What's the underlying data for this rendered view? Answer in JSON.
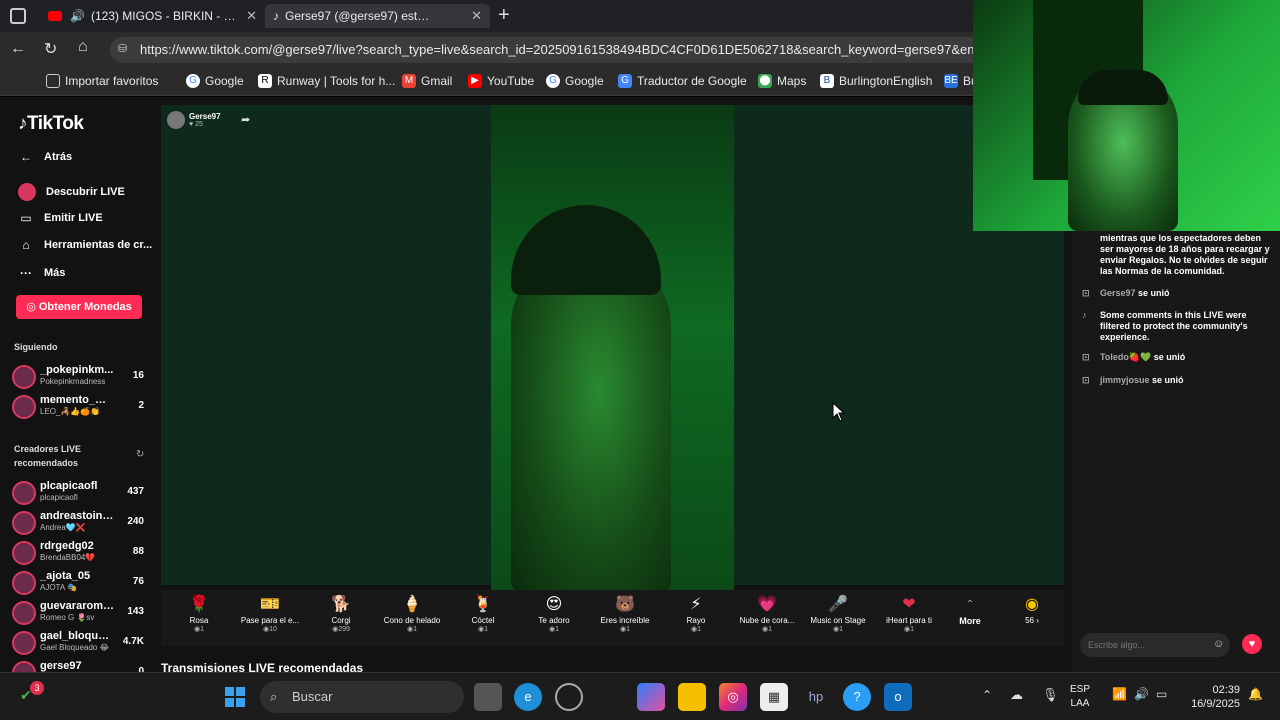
{
  "browser": {
    "tabs": [
      {
        "title": "(123) MIGOS - BIRKIN - 60 M",
        "icon": "youtube-icon"
      },
      {
        "title": "Gerse97 (@gerse97) está LIVE: Ti",
        "icon": "tiktok-icon"
      }
    ],
    "url": "https://www.tiktok.com/@gerse97/live?search_type=live&search_id=20250916153849​4BDC4CF0D61DE5062718&search_keyword=gerse97&ent",
    "bookmarks": [
      "Importar favoritos",
      "Google",
      "Runway | Tools for h...",
      "Gmail",
      "YouTube",
      "Google",
      "Traductor de Google",
      "Maps",
      "BurlingtonEnglish",
      "Bu"
    ]
  },
  "sidebar": {
    "logo": "TikTok",
    "back": "Atrás",
    "nav": [
      "Descubrir LIVE",
      "Emitir LIVE",
      "Herramientas de cr...",
      "Más"
    ],
    "coins_button": "Obtener Monedas",
    "following_label": "Siguiendo",
    "following": [
      {
        "name": "_pokepinkm...",
        "sub": "Pokepinkmadness",
        "count": "16"
      },
      {
        "name": "memento_mo...",
        "sub": "LEO_🦂👍🍊👏",
        "count": "2"
      }
    ],
    "recommended_label": "Creadores LIVE recomendados",
    "recommended": [
      {
        "name": "plcapicaofl",
        "sub": "plcapicaofl",
        "count": "437"
      },
      {
        "name": "andreastoinf...",
        "sub": "Andrea🩵❌",
        "count": "240"
      },
      {
        "name": "rdrgedg02",
        "sub": "BrendaBB04💔",
        "count": "88"
      },
      {
        "name": "_ajota_05",
        "sub": "AJOTA 🎭",
        "count": "76"
      },
      {
        "name": "guevararomeo",
        "sub": "Romeo G 🌷sv",
        "count": "143"
      },
      {
        "name": "gael_bloquea...",
        "sub": "Gael Bloqueado 😂",
        "count": "4.7K"
      },
      {
        "name": "gerse97",
        "sub": "",
        "count": "0"
      }
    ]
  },
  "stream": {
    "host": "Gerse97",
    "viewers": "25",
    "recommended_heading": "Transmisiones LIVE recomendadas"
  },
  "gifts": [
    {
      "name": "Rosa",
      "price": "1",
      "icon": "🌹"
    },
    {
      "name": "Pase para el e...",
      "price": "10",
      "icon": "🎫"
    },
    {
      "name": "Corgi",
      "price": "299",
      "icon": "🐕"
    },
    {
      "name": "Cono de helado",
      "price": "1",
      "icon": "🍦"
    },
    {
      "name": "Cóctel",
      "price": "1",
      "icon": "🍹"
    },
    {
      "name": "Te adoro",
      "price": "1",
      "icon": "😍"
    },
    {
      "name": "Eres increíble",
      "price": "1",
      "icon": "🐻"
    },
    {
      "name": "Rayo",
      "price": "1",
      "icon": "⚡"
    },
    {
      "name": "Nube de cora...",
      "price": "1",
      "icon": "💗"
    },
    {
      "name": "Music on Stage",
      "price": "1",
      "icon": "🎤"
    },
    {
      "name": "iHeart para ti",
      "price": "1",
      "icon": "❤"
    }
  ],
  "gift_more": "More",
  "coin_balance": "56",
  "chat": {
    "messages": [
      {
        "user": "",
        "text": "mientras que los espectadores deben ser mayores de 18 años para recargar y enviar Regalos. No te olvides de seguir las Normas de la comunidad."
      },
      {
        "user": "Gerse97",
        "text": "se unió"
      },
      {
        "user": "",
        "text": "Some comments in this LIVE were filtered to protect the community's experience."
      },
      {
        "user": "Toledo🍓💚",
        "text": "se unió"
      },
      {
        "user": "jimmyjosue",
        "text": "se unió"
      }
    ],
    "placeholder": "Escribe algo..."
  },
  "taskbar": {
    "search": "Buscar",
    "lang1": "ESP",
    "lang2": "LAA",
    "time": "02:39",
    "date": "16/9/2025",
    "badge": "3"
  }
}
